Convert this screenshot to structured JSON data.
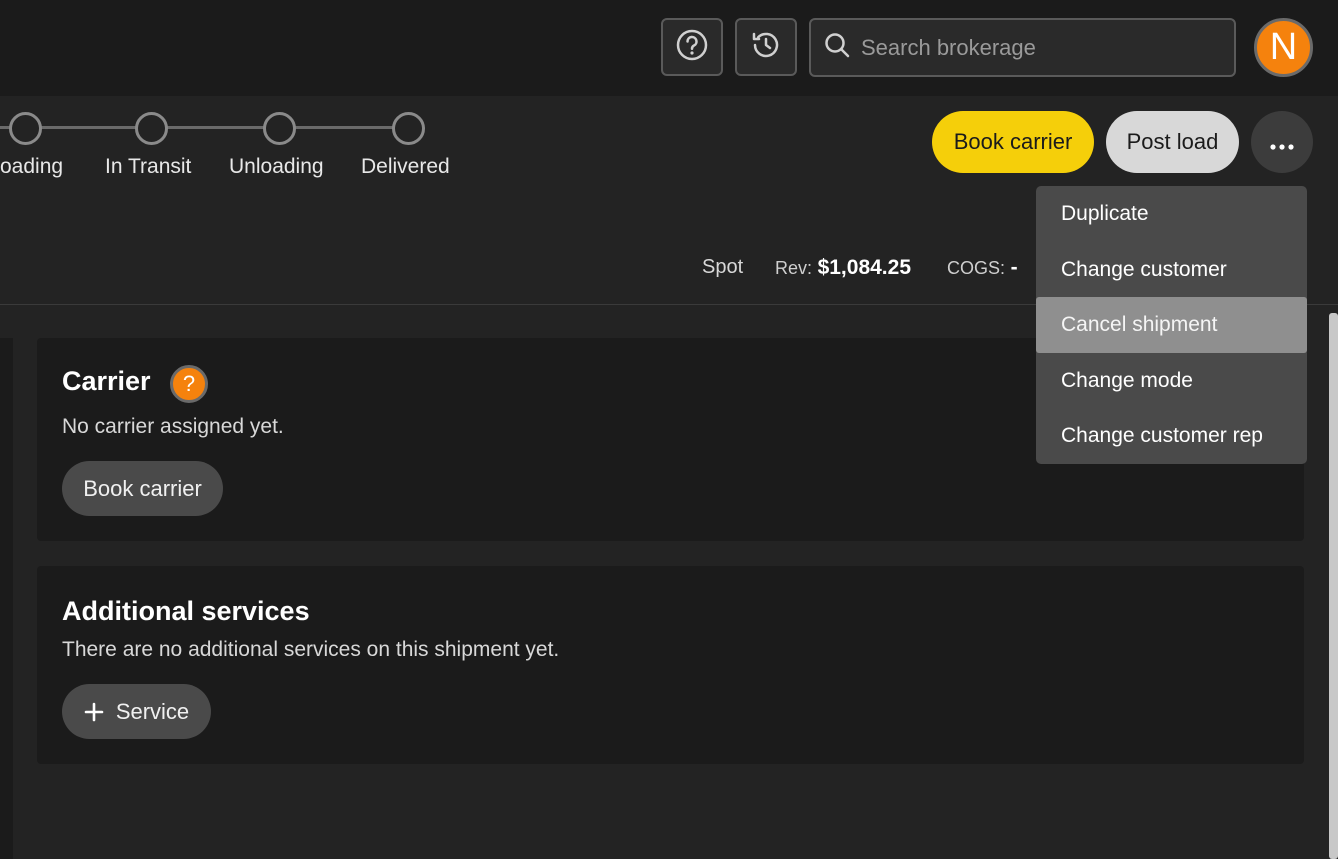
{
  "topbar": {
    "search_placeholder": "Search brokerage",
    "avatar_initial": "N"
  },
  "stepper": {
    "steps": [
      {
        "label": "oading"
      },
      {
        "label": "In Transit"
      },
      {
        "label": "Unloading"
      },
      {
        "label": "Delivered"
      }
    ]
  },
  "actions": {
    "book_carrier": "Book carrier",
    "post_load": "Post load",
    "more": "···"
  },
  "summary": {
    "type": "Spot",
    "rev_label": "Rev:",
    "rev_value": "$1,084.25",
    "cogs_label": "COGS:",
    "cogs_value": "-"
  },
  "menu": {
    "items": [
      {
        "label": "Duplicate"
      },
      {
        "label": "Change customer"
      },
      {
        "label": "Cancel shipment",
        "active": true
      },
      {
        "label": "Change mode"
      },
      {
        "label": "Change customer rep"
      }
    ]
  },
  "carrier_card": {
    "title": "Carrier",
    "help": "?",
    "message": "No carrier assigned yet.",
    "button": "Book carrier"
  },
  "services_card": {
    "title": "Additional services",
    "message": "There are no additional services on this shipment yet.",
    "button": "Service"
  },
  "colors": {
    "accent_yellow": "#f5cf0a",
    "accent_orange": "#f5820d",
    "background": "#232323",
    "card": "#1b1b1b"
  }
}
